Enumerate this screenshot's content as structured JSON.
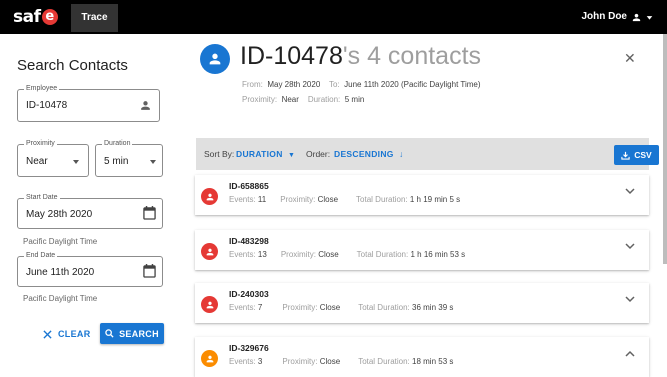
{
  "topbar": {
    "logo_text": "saf",
    "logo_e": "e",
    "tab_label": "Trace",
    "user_name": "John Doe"
  },
  "sidebar": {
    "title": "Search Contacts",
    "employee": {
      "label": "Employee",
      "value": "ID-10478"
    },
    "proximity": {
      "label": "Proximity",
      "value": "Near"
    },
    "duration": {
      "label": "Duration",
      "value": "5 min"
    },
    "start_date": {
      "label": "Start Date",
      "value": "May 28th 2020",
      "helper": "Pacific Daylight Time"
    },
    "end_date": {
      "label": "End Date",
      "value": "June 11th 2020",
      "helper": "Pacific Daylight Time"
    },
    "clear_label": "CLEAR",
    "search_label": "SEARCH"
  },
  "header": {
    "id": "ID-10478",
    "rest": "'s 4 contacts",
    "from_label": "From:",
    "from_value": "May 28th 2020",
    "to_label": "To:",
    "to_value": "June 11th 2020 (Pacific Daylight Time)",
    "proximity_label": "Proximity:",
    "proximity_value": "Near",
    "duration_label": "Duration:",
    "duration_value": "5 min"
  },
  "toolbar": {
    "sort_label": "Sort By:",
    "sort_value": "DURATION",
    "order_label": "Order:",
    "order_value": "DESCENDING",
    "csv_label": "CSV"
  },
  "contacts": [
    {
      "id": "ID-658865",
      "events_label": "Events:",
      "events": "11",
      "proximity_label": "Proximity:",
      "proximity": "Close",
      "duration_label": "Total Duration:",
      "duration": "1 h 19 min 5 s",
      "color": "#e53935",
      "expanded": false
    },
    {
      "id": "ID-483298",
      "events_label": "Events:",
      "events": "13",
      "proximity_label": "Proximity:",
      "proximity": "Close",
      "duration_label": "Total Duration:",
      "duration": "1 h 16 min 53 s",
      "color": "#e53935",
      "expanded": false
    },
    {
      "id": "ID-240303",
      "events_label": "Events:",
      "events": "7",
      "proximity_label": "Proximity:",
      "proximity": "Close",
      "duration_label": "Total Duration:",
      "duration": "36 min 39 s",
      "color": "#e53935",
      "expanded": false
    },
    {
      "id": "ID-329676",
      "events_label": "Events:",
      "events": "3",
      "proximity_label": "Proximity:",
      "proximity": "Close",
      "duration_label": "Total Duration:",
      "duration": "18 min 53 s",
      "color": "#fb8c00",
      "expanded": true
    }
  ],
  "colors": {
    "accent": "#1976d2",
    "topbar": "#000000",
    "toolbar_bg": "#e0e0e0"
  }
}
